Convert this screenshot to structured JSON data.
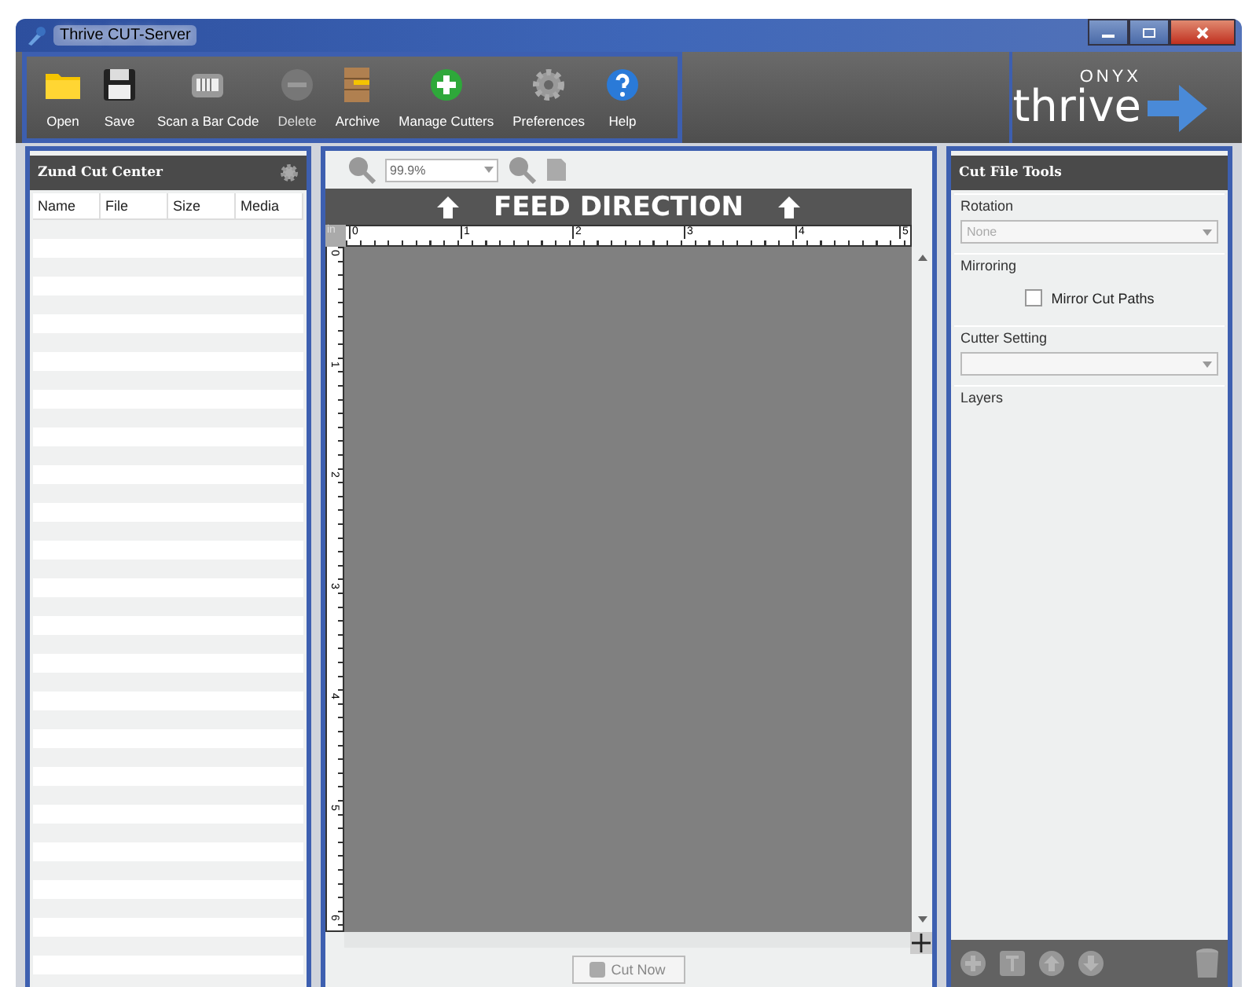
{
  "window": {
    "title": "Thrive CUT-Server"
  },
  "toolbar": [
    {
      "label": "Open",
      "disabled": false
    },
    {
      "label": "Save",
      "disabled": false
    },
    {
      "label": "Scan a Bar Code",
      "disabled": false
    },
    {
      "label": "Delete",
      "disabled": true
    },
    {
      "label": "Archive",
      "disabled": false
    },
    {
      "label": "Manage Cutters",
      "disabled": false
    },
    {
      "label": "Preferences",
      "disabled": false
    },
    {
      "label": "Help",
      "disabled": false
    }
  ],
  "logo": {
    "brand": "ONYX",
    "product": "thrive"
  },
  "left_panel": {
    "title": "Zund Cut Center",
    "columns": [
      "Name",
      "File",
      "Size",
      "Media"
    ]
  },
  "canvas": {
    "zoom": "99.9%",
    "banner": "FEED DIRECTION",
    "unit": "in",
    "xticks": [
      "0",
      "1",
      "2",
      "3",
      "4",
      "5"
    ],
    "yticks": [
      "0",
      "1",
      "2",
      "3",
      "4",
      "5",
      "6"
    ],
    "cut_button": "Cut Now",
    "cut_disabled": true
  },
  "right_panel": {
    "title": "Cut File Tools",
    "rotation": {
      "label": "Rotation",
      "value": "None"
    },
    "mirroring": {
      "label": "Mirroring",
      "option": "Mirror Cut Paths",
      "checked": false
    },
    "cutter_setting": {
      "label": "Cutter Setting"
    },
    "layers": {
      "label": "Layers"
    },
    "buttons_disabled": true
  }
}
